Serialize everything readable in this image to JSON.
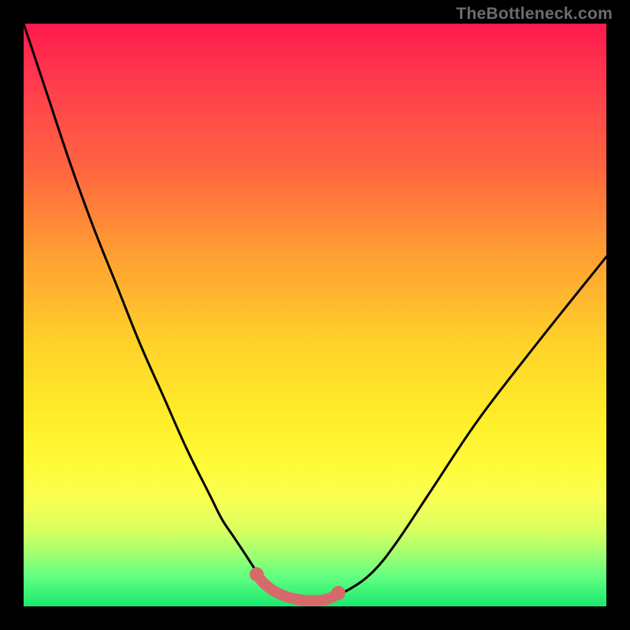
{
  "attribution": "TheBottleneck.com",
  "colors": {
    "frame": "#000000",
    "curve_main": "#000000",
    "curve_highlight": "#d66a6a",
    "gradient_top": "#ff1a4d",
    "gradient_bottom": "#18e96e"
  },
  "chart_data": {
    "type": "line",
    "title": "",
    "xlabel": "",
    "ylabel": "",
    "xlim": [
      0,
      100
    ],
    "ylim": [
      0,
      100
    ],
    "grid": false,
    "legend": false,
    "series": [
      {
        "name": "bottleneck-main-curve",
        "color": "#000000",
        "x": [
          0,
          4,
          8,
          12,
          16,
          20,
          24,
          28,
          32,
          34,
          36,
          38,
          40,
          42,
          44,
          46,
          48,
          50,
          52,
          56,
          60,
          64,
          70,
          78,
          88,
          100
        ],
        "y": [
          100,
          88,
          76,
          65,
          55,
          45,
          36,
          27,
          19,
          15,
          12,
          9,
          6,
          4,
          2.5,
          1.5,
          1,
          1,
          1.3,
          3,
          6,
          11,
          20,
          32,
          45,
          60
        ]
      },
      {
        "name": "bottleneck-flat-highlight",
        "color": "#d66a6a",
        "x": [
          40,
          41,
          42,
          43,
          44,
          45,
          46,
          47,
          48,
          49,
          50,
          51,
          52,
          53,
          54
        ],
        "y": [
          5.5,
          4.2,
          3.3,
          2.6,
          2.1,
          1.7,
          1.4,
          1.2,
          1.05,
          1,
          1,
          1.05,
          1.2,
          1.6,
          2.3
        ]
      }
    ],
    "highlight_endpoints": {
      "points_x": [
        40,
        54
      ],
      "points_y": [
        5.5,
        2.3
      ],
      "radius": 6
    }
  }
}
